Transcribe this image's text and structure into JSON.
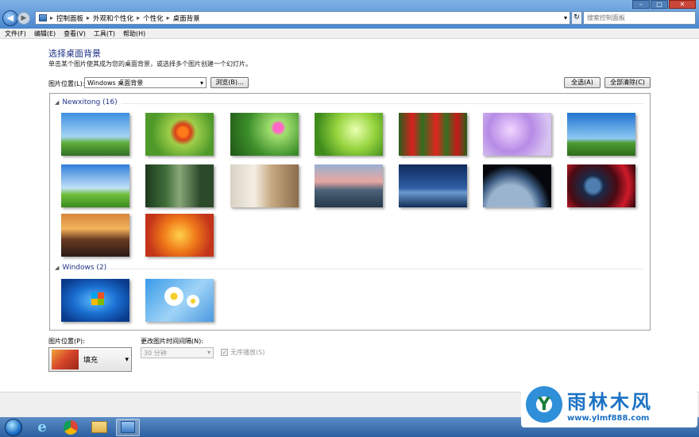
{
  "window": {
    "breadcrumbs": [
      "控制面板",
      "外观和个性化",
      "个性化",
      "桌面背景"
    ],
    "search_placeholder": "搜索控制面板",
    "buttons": {
      "minimize": "–",
      "maximize": "□",
      "close": "✕"
    }
  },
  "menu": [
    "文件(F)",
    "编辑(E)",
    "查看(V)",
    "工具(T)",
    "帮助(H)"
  ],
  "page": {
    "title": "选择桌面背景",
    "description": "单击某个图片使其成为您的桌面背景，或选择多个图片创建一个幻灯片。",
    "location_label": "图片位置(L):",
    "location_value": "Windows 桌面背景",
    "browse_button": "浏览(B)...",
    "select_all_button": "全选(A)",
    "clear_all_button": "全部清除(C)"
  },
  "groups": [
    {
      "label": "Newxitong (16)"
    },
    {
      "label": "Windows (2)"
    }
  ],
  "bottom": {
    "position_label": "图片位置(P):",
    "position_value": "填充",
    "interval_label": "更改图片时间间隔(N):",
    "interval_value": "30 分钟",
    "shuffle_label": "无序播放(S)"
  },
  "watermark": {
    "title": "雨林木风",
    "url": "www.ylmf888.com"
  },
  "colors": {
    "title_blue": "#1e3287",
    "titlebar": "#4a87cf",
    "watermark_blue": "#1b72c4"
  }
}
